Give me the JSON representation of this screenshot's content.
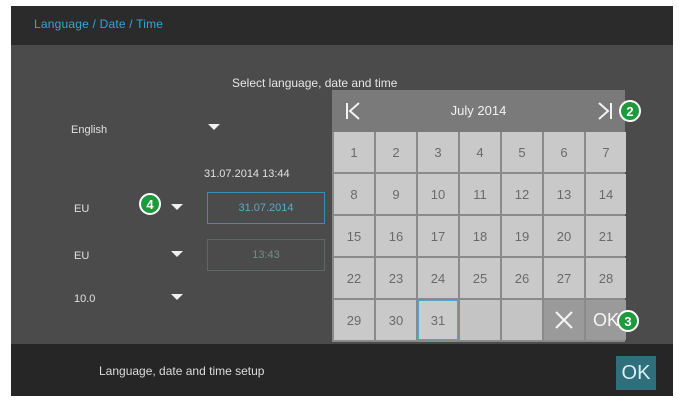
{
  "header": {
    "title": "Language / Date / Time"
  },
  "heading": "Select language, date and time",
  "settings": {
    "language": "English",
    "datetime_display": "31.07.2014 13:44",
    "date_format": "EU",
    "date_value": "31.07.2014",
    "time_format": "EU",
    "time_value": "13:43",
    "version": "10.0"
  },
  "calendar": {
    "month_label": "July 2014",
    "days": [
      "1",
      "2",
      "3",
      "4",
      "5",
      "6",
      "7",
      "8",
      "9",
      "10",
      "11",
      "12",
      "13",
      "14",
      "15",
      "16",
      "17",
      "18",
      "19",
      "20",
      "21",
      "22",
      "23",
      "24",
      "25",
      "26",
      "27",
      "28",
      "29",
      "30",
      "31"
    ],
    "selected_day": "31",
    "cancel_symbol": "✕",
    "ok_label": "OK"
  },
  "footer": {
    "status": "Language, date and time setup",
    "ok_label": "OK"
  },
  "callouts": [
    "2",
    "3",
    "4"
  ],
  "colors": {
    "accent": "#33a6d8",
    "badge": "#1e9a3c",
    "panel": "#4b4b4b"
  }
}
